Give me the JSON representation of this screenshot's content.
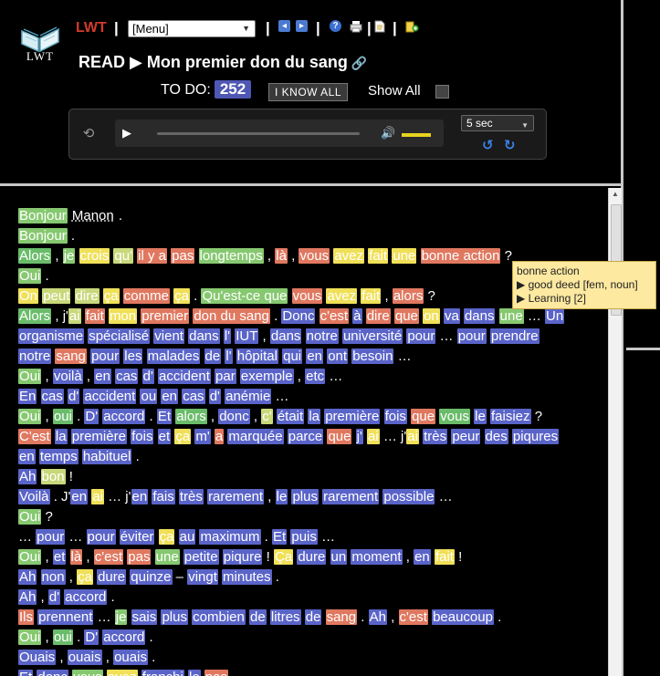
{
  "header": {
    "app_name": "LWT",
    "logo_text": "LWT",
    "menu_value": "[Menu]",
    "separator": "|",
    "read_title": "READ ▶ Mon premier don du sang",
    "todo_label": "TO DO:",
    "todo_count": "252",
    "iknow_label": "I KNOW ALL",
    "show_all_label": "Show All"
  },
  "player": {
    "seek_value": "5 sec",
    "volume_level": 0.8,
    "progress": 0
  },
  "tooltip": {
    "term": "bonne action",
    "translation": "▶ good deed [fem, noun]",
    "status": "▶ Learning [2]"
  },
  "text_lines": [
    [
      [
        "Bonjour",
        "s4"
      ],
      [
        "Manon",
        "dot"
      ],
      [
        ".",
        ""
      ]
    ],
    [
      [
        "Bonjour",
        "s4"
      ],
      [
        ".",
        ""
      ]
    ],
    [
      [
        "Alors",
        "s5"
      ],
      [
        ", ",
        ""
      ],
      [
        "je",
        "s4"
      ],
      [
        "crois",
        "s2"
      ],
      [
        "qu'",
        "s3"
      ],
      [
        "il y a",
        "s1"
      ],
      [
        "pas",
        "s1"
      ],
      [
        "longtemps",
        "s4"
      ],
      [
        ", ",
        ""
      ],
      [
        "là",
        "s1"
      ],
      [
        ", ",
        ""
      ],
      [
        "vous",
        "s1"
      ],
      [
        "avez",
        "s2"
      ],
      [
        "fait",
        "s2"
      ],
      [
        "une",
        "s2"
      ],
      [
        "bonne action",
        "s1"
      ],
      [
        " ?",
        ""
      ]
    ],
    [
      [
        "Oui",
        "s4"
      ],
      [
        ".",
        ""
      ]
    ],
    [
      [
        "On",
        "s2"
      ],
      [
        "peut",
        "s3"
      ],
      [
        "dire",
        "s3"
      ],
      [
        "ça",
        "s2"
      ],
      [
        "comme",
        "s1"
      ],
      [
        "ça",
        "s2"
      ],
      [
        ". ",
        ""
      ],
      [
        "Qu'est-ce que",
        "s4"
      ],
      [
        "vous",
        "s1"
      ],
      [
        "avez",
        "s2"
      ],
      [
        "fait",
        "s2"
      ],
      [
        ", ",
        ""
      ],
      [
        "alors",
        "s1"
      ],
      [
        " ?",
        ""
      ]
    ],
    [
      [
        "Alors",
        "s5"
      ],
      [
        ", j'",
        ""
      ],
      [
        "ai",
        "s3"
      ],
      [
        "fait",
        "s1"
      ],
      [
        "mon",
        "s2"
      ],
      [
        "premier",
        "s1"
      ],
      [
        "don du sang",
        "s1"
      ],
      [
        ". ",
        ""
      ],
      [
        "Donc",
        "unk"
      ],
      [
        "c'est",
        "s1"
      ],
      [
        "à",
        "unk"
      ],
      [
        "dire",
        "s1"
      ],
      [
        "que",
        "s1"
      ],
      [
        "on",
        "s2"
      ],
      [
        "va",
        "unk"
      ],
      [
        "dans",
        "unk"
      ],
      [
        "une",
        "s4"
      ],
      [
        "… ",
        ""
      ],
      [
        "Un",
        "unk"
      ]
    ],
    [
      [
        "organisme",
        "unk"
      ],
      [
        "spécialisé",
        "unk"
      ],
      [
        "vient",
        "unk"
      ],
      [
        "dans",
        "unk"
      ],
      [
        "l'",
        "unk"
      ],
      [
        "IUT",
        "unk"
      ],
      [
        ", ",
        ""
      ],
      [
        "dans",
        "unk"
      ],
      [
        "notre",
        "unk"
      ],
      [
        "université",
        "unk"
      ],
      [
        "pour",
        "unk"
      ],
      [
        "… ",
        ""
      ],
      [
        "pour",
        "unk"
      ],
      [
        "prendre",
        "unk"
      ]
    ],
    [
      [
        "notre",
        "unk"
      ],
      [
        "sang",
        "s1"
      ],
      [
        "pour",
        "unk"
      ],
      [
        "les",
        "unk"
      ],
      [
        "malades",
        "unk"
      ],
      [
        "de",
        "unk"
      ],
      [
        "l'",
        "unk"
      ],
      [
        "hôpital",
        "unk"
      ],
      [
        "qui",
        "unk"
      ],
      [
        "en",
        "unk"
      ],
      [
        "ont",
        "unk"
      ],
      [
        "besoin",
        "unk"
      ],
      [
        "…",
        ""
      ]
    ],
    [
      [
        "Oui",
        "s4"
      ],
      [
        ", ",
        ""
      ],
      [
        "voilà",
        "unk"
      ],
      [
        ", ",
        ""
      ],
      [
        "en",
        "unk"
      ],
      [
        "cas",
        "unk"
      ],
      [
        "d'",
        "unk"
      ],
      [
        "accident",
        "unk"
      ],
      [
        "par",
        "unk"
      ],
      [
        "exemple",
        "unk"
      ],
      [
        ", ",
        ""
      ],
      [
        "etc",
        "unk"
      ],
      [
        "…",
        ""
      ]
    ],
    [
      [
        "En",
        "unk"
      ],
      [
        "cas",
        "unk"
      ],
      [
        "d'",
        "unk"
      ],
      [
        "accident",
        "unk"
      ],
      [
        "ou",
        "unk"
      ],
      [
        "en",
        "unk"
      ],
      [
        "cas",
        "unk"
      ],
      [
        "d'",
        "unk"
      ],
      [
        "anémie",
        "unk"
      ],
      [
        " …",
        ""
      ]
    ],
    [
      [
        "Oui",
        "s4"
      ],
      [
        ", ",
        ""
      ],
      [
        "oui",
        "s5"
      ],
      [
        ". ",
        ""
      ],
      [
        "D'",
        "unk"
      ],
      [
        "accord",
        "unk"
      ],
      [
        ". ",
        ""
      ],
      [
        "Et",
        "unk"
      ],
      [
        "alors",
        "s5"
      ],
      [
        ", ",
        ""
      ],
      [
        "donc",
        "unk"
      ],
      [
        ", ",
        ""
      ],
      [
        "c'",
        "s3"
      ],
      [
        "était",
        "unk"
      ],
      [
        "la",
        "unk"
      ],
      [
        "première",
        "unk"
      ],
      [
        "fois",
        "unk"
      ],
      [
        "que",
        "s1"
      ],
      [
        "vous",
        "s5"
      ],
      [
        "le",
        "unk"
      ],
      [
        "faisiez",
        "unk"
      ],
      [
        " ?",
        ""
      ]
    ],
    [
      [
        "C'est",
        "s1"
      ],
      [
        "la",
        "unk"
      ],
      [
        "première",
        "unk"
      ],
      [
        "fois",
        "unk"
      ],
      [
        "et",
        "unk"
      ],
      [
        "ça",
        "s2"
      ],
      [
        "m'",
        "unk"
      ],
      [
        "a",
        "s1"
      ],
      [
        "marquée",
        "unk"
      ],
      [
        "parce",
        "unk"
      ],
      [
        "que",
        "s1"
      ],
      [
        "j'",
        "unk"
      ],
      [
        "ai",
        "s2"
      ],
      [
        "… j'",
        ""
      ],
      [
        "ai",
        "s2"
      ],
      [
        "très",
        "unk"
      ],
      [
        "peur",
        "unk"
      ],
      [
        "des",
        "unk"
      ],
      [
        "piqures",
        "unk"
      ]
    ],
    [
      [
        "en",
        "unk"
      ],
      [
        "temps",
        "unk"
      ],
      [
        "habituel",
        "unk"
      ],
      [
        ".",
        ""
      ]
    ],
    [
      [
        "Ah",
        "unk"
      ],
      [
        "bon",
        "s3"
      ],
      [
        " !",
        ""
      ]
    ],
    [
      [
        "Voilà",
        "unk"
      ],
      [
        ". J'",
        ""
      ],
      [
        "en",
        "unk"
      ],
      [
        "ai",
        "s2"
      ],
      [
        "… j'",
        ""
      ],
      [
        "en",
        "unk"
      ],
      [
        "fais",
        "unk"
      ],
      [
        "très",
        "unk"
      ],
      [
        "rarement",
        "unk"
      ],
      [
        ", ",
        ""
      ],
      [
        "le",
        "unk"
      ],
      [
        "plus",
        "unk"
      ],
      [
        "rarement",
        "unk"
      ],
      [
        "possible",
        "unk"
      ],
      [
        "…",
        ""
      ]
    ],
    [
      [
        "Oui",
        "s4"
      ],
      [
        " ?",
        ""
      ]
    ],
    [
      [
        "… ",
        ""
      ],
      [
        "pour",
        "unk"
      ],
      [
        "… ",
        ""
      ],
      [
        "pour",
        "unk"
      ],
      [
        "éviter",
        "unk"
      ],
      [
        "ça",
        "s2"
      ],
      [
        "au",
        "unk"
      ],
      [
        "maximum",
        "unk"
      ],
      [
        ". ",
        ""
      ],
      [
        "Et",
        "unk"
      ],
      [
        "puis",
        "unk"
      ],
      [
        "…",
        ""
      ]
    ],
    [
      [
        "Oui",
        "s4"
      ],
      [
        ", ",
        ""
      ],
      [
        "et",
        "unk"
      ],
      [
        "là",
        "s1"
      ],
      [
        ", ",
        ""
      ],
      [
        "c'est",
        "s1"
      ],
      [
        "pas",
        "s1"
      ],
      [
        "une",
        "s4"
      ],
      [
        "petite",
        "unk"
      ],
      [
        "piqure",
        "unk"
      ],
      [
        " ! ",
        ""
      ],
      [
        "Ça",
        "s2"
      ],
      [
        "dure",
        "unk"
      ],
      [
        "un",
        "unk"
      ],
      [
        "moment",
        "unk"
      ],
      [
        ", ",
        ""
      ],
      [
        "en",
        "unk"
      ],
      [
        "fait",
        "s2"
      ],
      [
        " !",
        ""
      ]
    ],
    [
      [
        "Ah",
        "unk"
      ],
      [
        "non",
        "unk"
      ],
      [
        ", ",
        ""
      ],
      [
        "ça",
        "s2"
      ],
      [
        "dure",
        "unk"
      ],
      [
        "quinze",
        "unk"
      ],
      [
        " – ",
        ""
      ],
      [
        "vingt",
        "unk"
      ],
      [
        "minutes",
        "unk"
      ],
      [
        ".",
        ""
      ]
    ],
    [
      [
        "Ah",
        "unk"
      ],
      [
        ", ",
        ""
      ],
      [
        "d'",
        "unk"
      ],
      [
        "accord",
        "unk"
      ],
      [
        ".",
        ""
      ]
    ],
    [
      [
        "Ils",
        "s1"
      ],
      [
        "prennent",
        "unk"
      ],
      [
        "… ",
        ""
      ],
      [
        "je",
        "s4"
      ],
      [
        "sais",
        "unk"
      ],
      [
        "plus",
        "unk"
      ],
      [
        "combien",
        "unk"
      ],
      [
        "de",
        "unk"
      ],
      [
        "litres",
        "unk"
      ],
      [
        "de",
        "unk"
      ],
      [
        "sang",
        "s1"
      ],
      [
        ". ",
        ""
      ],
      [
        "Ah",
        "unk"
      ],
      [
        ", ",
        ""
      ],
      [
        "c'est",
        "s1"
      ],
      [
        "beaucoup",
        "unk"
      ],
      [
        ".",
        ""
      ]
    ],
    [
      [
        "Oui",
        "s4"
      ],
      [
        ", ",
        ""
      ],
      [
        "oui",
        "s5"
      ],
      [
        ". ",
        ""
      ],
      [
        "D'",
        "unk"
      ],
      [
        "accord",
        "unk"
      ],
      [
        ".",
        ""
      ]
    ],
    [
      [
        "Ouais",
        "unk"
      ],
      [
        ", ",
        ""
      ],
      [
        "ouais",
        "unk"
      ],
      [
        ", ",
        ""
      ],
      [
        "ouais",
        "unk"
      ],
      [
        ".",
        ""
      ]
    ],
    [
      [
        "Et",
        "unk"
      ],
      [
        "donc",
        "unk"
      ],
      [
        "vous",
        "s4"
      ],
      [
        "avez",
        "s2"
      ],
      [
        "franchi",
        "unk"
      ],
      [
        "le",
        "unk"
      ],
      [
        "pas",
        "s1"
      ]
    ]
  ],
  "colors": {
    "unknown": "#5a64c8",
    "status1": "#e07860",
    "status2": "#f0e058",
    "status3": "#c8d87a",
    "status4": "#86c870",
    "status5": "#6abc6a",
    "brand": "#d23b2a"
  },
  "icons": {
    "logo": "open-book-icon",
    "prev": "arrow-left-icon",
    "next": "arrow-right-icon",
    "help": "question-icon",
    "print": "printer-icon",
    "edit": "document-icon",
    "new": "new-document-icon",
    "link": "chain-link-icon",
    "repeat": "repeat-icon",
    "play": "play-icon",
    "volume": "volume-icon",
    "rewind": "rewind-icon",
    "forward": "forward-icon"
  }
}
